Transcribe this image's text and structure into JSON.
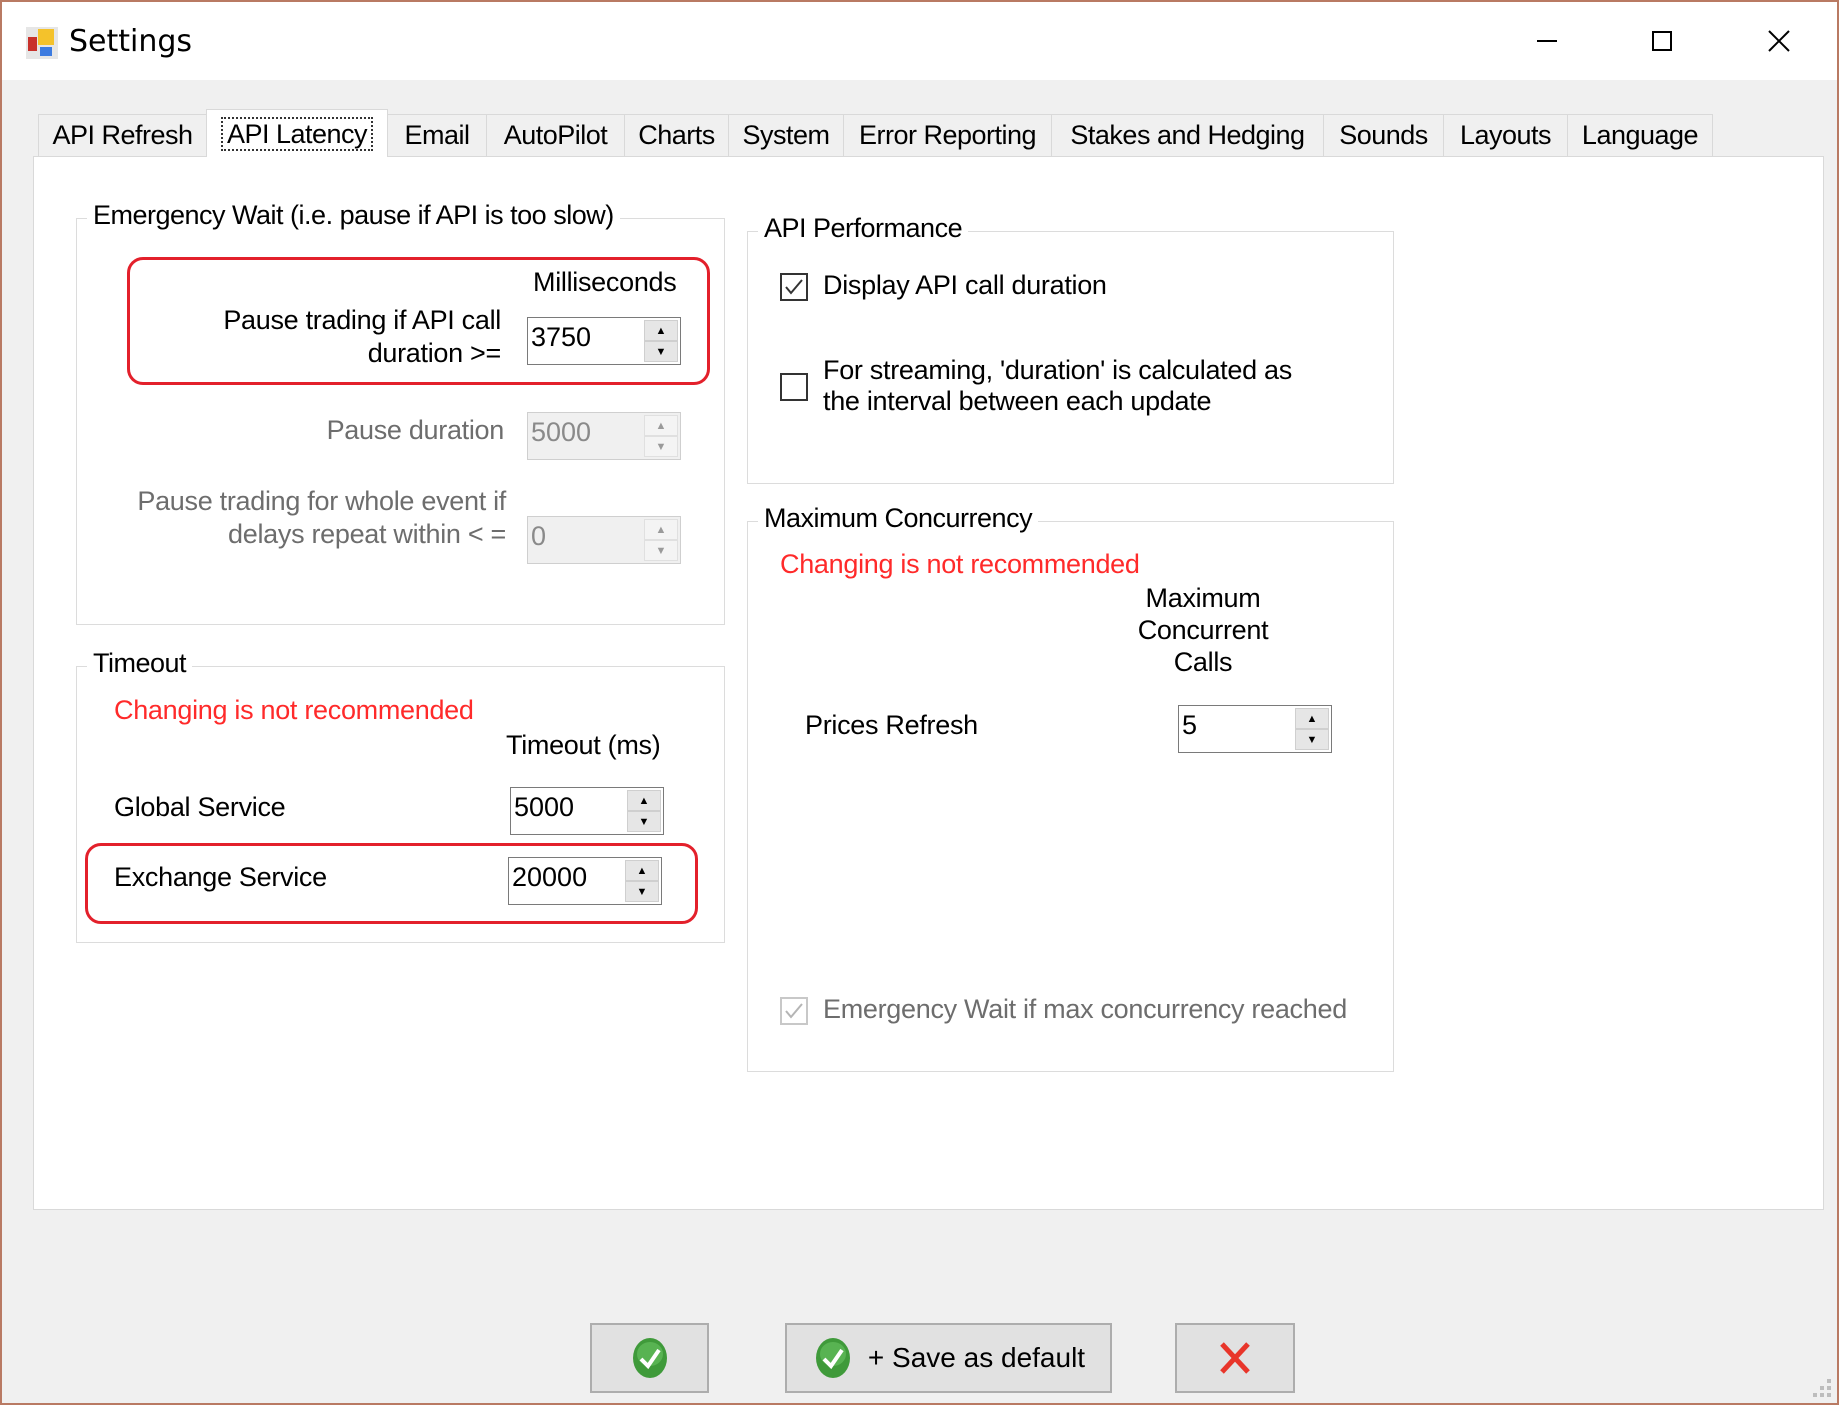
{
  "window": {
    "title": "Settings",
    "icons": {
      "app": "settings-app-icon",
      "minimize": "minimize-icon",
      "maximize": "maximize-icon",
      "close": "close-icon"
    }
  },
  "tabs": [
    {
      "label": "API Refresh",
      "active": false
    },
    {
      "label": "API Latency",
      "active": true
    },
    {
      "label": "Email",
      "active": false
    },
    {
      "label": "AutoPilot",
      "active": false
    },
    {
      "label": "Charts",
      "active": false
    },
    {
      "label": "System",
      "active": false
    },
    {
      "label": "Error Reporting",
      "active": false
    },
    {
      "label": "Stakes and Hedging",
      "active": false
    },
    {
      "label": "Sounds",
      "active": false
    },
    {
      "label": "Layouts",
      "active": false
    },
    {
      "label": "Language",
      "active": false
    }
  ],
  "emergency_wait": {
    "title": "Emergency Wait (i.e. pause if API is too slow)",
    "unit_header": "Milliseconds",
    "pause_if_label_line1": "Pause trading if API call",
    "pause_if_label_line2": "duration  >=",
    "pause_if_value": "3750",
    "pause_duration_label": "Pause duration",
    "pause_duration_value": "5000",
    "whole_event_label_line1": "Pause trading for whole event if",
    "whole_event_label_line2": "delays repeat within < =",
    "whole_event_value": "0"
  },
  "timeout": {
    "title": "Timeout",
    "warning": "Changing is not recommended",
    "unit_header": "Timeout (ms)",
    "global_label": "Global Service",
    "global_value": "5000",
    "exchange_label": "Exchange Service",
    "exchange_value": "20000"
  },
  "api_performance": {
    "title": "API Performance",
    "display_duration_label": "Display API call duration",
    "display_duration_checked": true,
    "streaming_label_line1": "For streaming, 'duration' is calculated as",
    "streaming_label_line2": "the interval between each update",
    "streaming_checked": false
  },
  "max_concurrency": {
    "title": "Maximum Concurrency",
    "warning": "Changing is not recommended",
    "header_line1": "Maximum",
    "header_line2": "Concurrent",
    "header_line3": "Calls",
    "prices_refresh_label": "Prices Refresh",
    "prices_refresh_value": "5",
    "emergency_wait_label": "Emergency Wait if max concurrency reached",
    "emergency_wait_checked": true
  },
  "buttons": {
    "ok_icon": "green-check-icon",
    "save_default_label": "+ Save as default",
    "cancel_icon": "red-x-icon"
  },
  "colors": {
    "warning_red": "#ff2a2a",
    "highlight_red": "#e3202b",
    "window_border": "#b97a63"
  }
}
